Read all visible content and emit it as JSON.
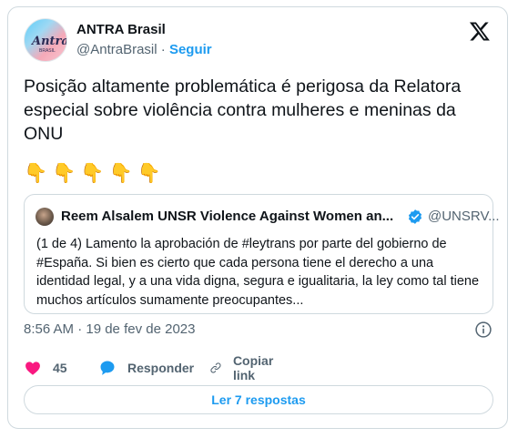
{
  "author": {
    "name": "ANTRA Brasil",
    "handle": "@AntraBrasil",
    "separator": "·",
    "follow_label": "Seguir",
    "avatar_text": "Antra",
    "avatar_subtext": "BRASIL"
  },
  "tweet": {
    "text": "Posição altamente problemática é perigosa da Relatora especial sobre violência contra mulheres e meninas da ONU",
    "emojis": [
      "👇",
      "👇",
      "👇",
      "👇",
      "👇"
    ]
  },
  "quoted": {
    "name": "Reem Alsalem UNSR Violence Against Women an...",
    "handle": "@UNSRV...",
    "verified": true,
    "text": "(1 de 4) Lamento la aprobación  de #leytrans por parte del gobierno de #España. Si bien es cierto que cada persona tiene el derecho a una identidad legal, y a una vida digna, segura e igualitaria,  la ley como tal tiene muchos artículos sumamente preocupantes..."
  },
  "timestamp": "8:56 AM · 19 de fev de 2023",
  "actions": {
    "like_count": "45",
    "reply_label": "Responder",
    "copy_label": "Copiar link"
  },
  "read_replies_label": "Ler 7 respostas",
  "colors": {
    "accent": "#1d9bf0",
    "like": "#f91880",
    "muted": "#536471",
    "border": "#cfd9de"
  },
  "icons": [
    "x-logo-icon",
    "verified-badge-icon",
    "info-icon",
    "heart-icon",
    "reply-bubble-icon",
    "link-icon"
  ]
}
